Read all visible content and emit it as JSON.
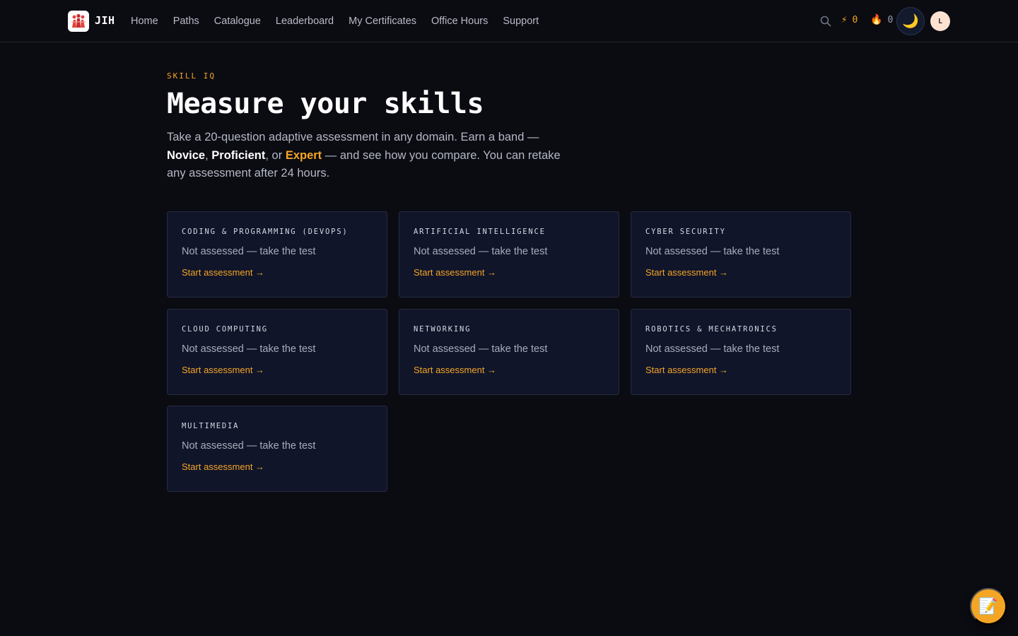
{
  "header": {
    "brand": "JIH",
    "nav": [
      "Home",
      "Paths",
      "Catalogue",
      "Leaderboard",
      "My Certificates",
      "Office Hours",
      "Support"
    ],
    "xp_count": "0",
    "streak_count": "0",
    "avatar_initial": "L",
    "icons": {
      "search": "search-icon",
      "xp": "lightning-icon",
      "streak": "flame-icon",
      "theme": "moon-icon"
    }
  },
  "hero": {
    "eyebrow": "SKILL IQ",
    "title": "Measure your skills",
    "intro_part1": "Take a 20-question adaptive assessment in any domain. Earn a band — ",
    "band_novice": "Novice",
    "sep1": ", ",
    "band_proficient": "Proficient",
    "sep2": ", or ",
    "band_expert": "Expert",
    "intro_part2": " — and see how you compare. You can retake any assessment after 24 hours."
  },
  "domains": [
    {
      "title": "CODING & PROGRAMMING (DEVOPS)",
      "status": "Not assessed — take the test",
      "action": "Start assessment →"
    },
    {
      "title": "ARTIFICIAL INTELLIGENCE",
      "status": "Not assessed — take the test",
      "action": "Start assessment →"
    },
    {
      "title": "CYBER SECURITY",
      "status": "Not assessed — take the test",
      "action": "Start assessment →"
    },
    {
      "title": "CLOUD COMPUTING",
      "status": "Not assessed — take the test",
      "action": "Start assessment →"
    },
    {
      "title": "NETWORKING",
      "status": "Not assessed — take the test",
      "action": "Start assessment →"
    },
    {
      "title": "ROBOTICS & MECHATRONICS",
      "status": "Not assessed — take the test",
      "action": "Start assessment →"
    },
    {
      "title": "MULTIMEDIA",
      "status": "Not assessed — take the test",
      "action": "Start assessment →"
    }
  ],
  "fab_icon": "notepad-icon",
  "colors": {
    "background": "#0b0b12",
    "card": "#10152a",
    "accent": "#f5a524"
  }
}
